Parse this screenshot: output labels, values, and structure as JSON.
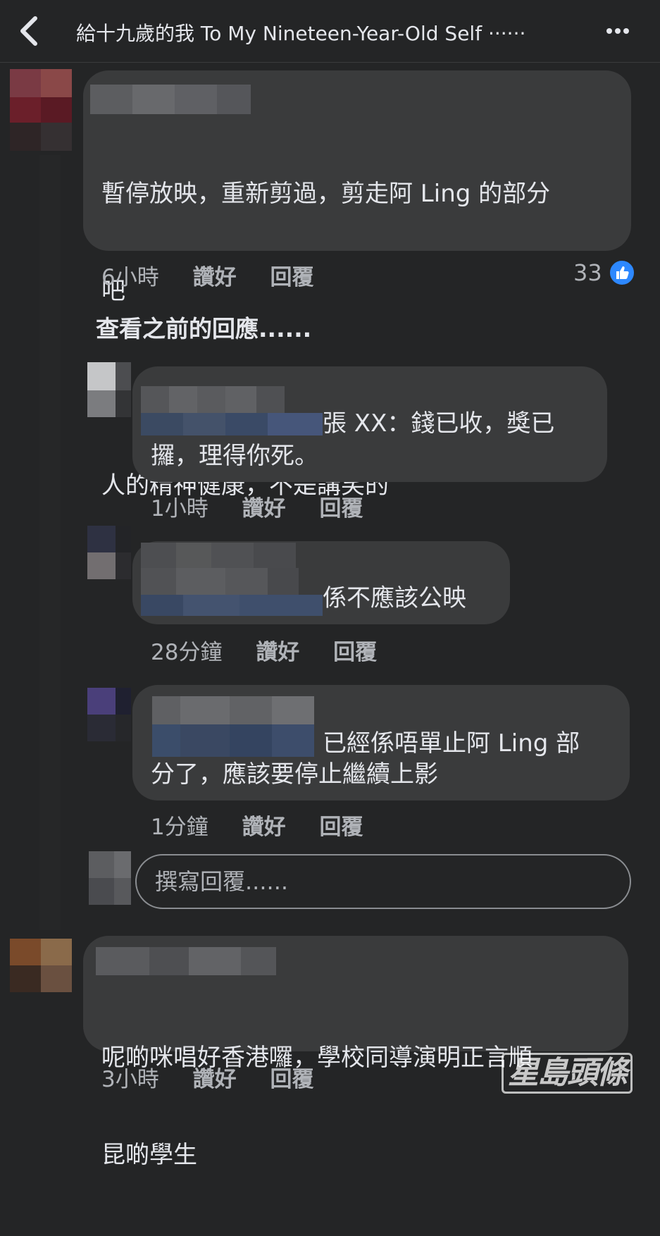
{
  "header": {
    "title": "給十九歲的我  To My Nineteen-Year-Old Self ······",
    "back_icon": "chevron-left-icon",
    "more_icon": "more-dots-icon"
  },
  "comments": [
    {
      "name": "C        N    k",
      "lines": [
        "暫停放映，重新剪過，剪走阿 Ling 的部分",
        "吧",
        "",
        "人的精神健康，不是講笑的"
      ],
      "time": "6小時",
      "like_label": "讚好",
      "reply_label": "回覆",
      "reaction_count": "33"
    }
  ],
  "view_previous": "查看之前的回應......",
  "replies": [
    {
      "name": "Kitt  Ch",
      "lines": [
        "張 XX：錢已收，獎已",
        "攞，理得你死。"
      ],
      "time": "1小時",
      "like_label": "讚好",
      "reply_label": "回覆"
    },
    {
      "lines": [
        "係不應該公映"
      ],
      "time": "28分鐘",
      "like_label": "讚好",
      "reply_label": "回覆"
    },
    {
      "lines": [
        "已經係唔單止阿 Ling 部",
        "分了，應該要停止繼續上影"
      ],
      "time": "1分鐘",
      "like_label": "讚好",
      "reply_label": "回覆"
    }
  ],
  "reply_box": {
    "placeholder": "撰寫回覆......"
  },
  "comment2": {
    "lines": [
      "呢啲咪唱好香港囉，學校同導演明正言順",
      "昆啲學生"
    ],
    "time": "3小時",
    "like_label": "讚好",
    "reply_label": "回覆"
  },
  "watermark": "星島頭條",
  "colors": {
    "background": "#242526",
    "bubble": "#3a3b3c",
    "text": "#e4e6eb",
    "meta": "#b0b3b8",
    "like_blue": "#2d88ff"
  }
}
